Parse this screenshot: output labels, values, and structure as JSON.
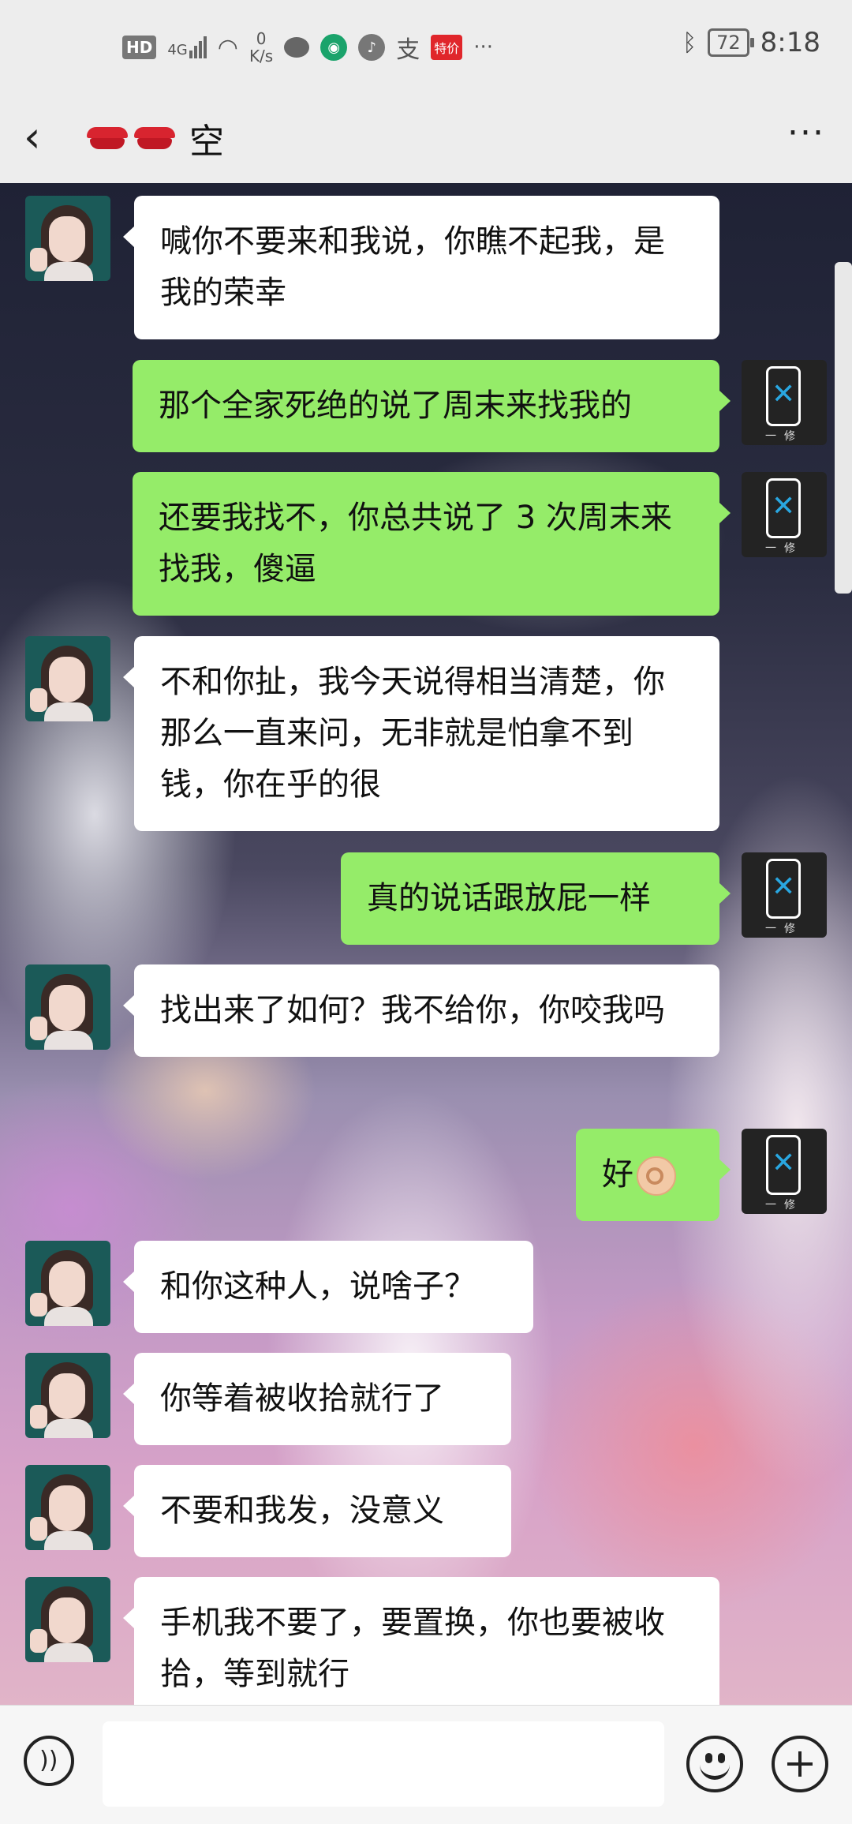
{
  "status_bar": {
    "hd": "HD",
    "network": "4G",
    "speed_value": "0",
    "speed_unit": "K/s",
    "pay_icon": "支",
    "sale_badge": "特价",
    "more": "···",
    "battery": "72",
    "time": "8:18"
  },
  "header": {
    "back_icon": "‹",
    "title": "空",
    "more_icon": "···"
  },
  "messages": [
    {
      "from": "other",
      "text": "喊你不要来和我说，你瞧不起我，是我的荣幸"
    },
    {
      "from": "me",
      "text": "那个全家死绝的说了周末来找我的"
    },
    {
      "from": "me",
      "text": "还要我找不，你总共说了 3 次周末来找我，傻逼"
    },
    {
      "from": "other",
      "text": "不和你扯，我今天说得相当清楚，你那么一直来问，无非就是怕拿不到钱，你在乎的很"
    },
    {
      "from": "me",
      "text": "真的说话跟放屁一样"
    },
    {
      "from": "other",
      "text": "找出来了如何？我不给你，你咬我吗"
    },
    {
      "from": "me",
      "text": "好"
    },
    {
      "from": "other",
      "text": "和你这种人，说啥子？"
    },
    {
      "from": "other",
      "text": "你等着被收拾就行了"
    },
    {
      "from": "other",
      "text": "不要和我发，没意义"
    },
    {
      "from": "other",
      "text": "手机我不要了，要置换，你也要被收拾，等到就行"
    }
  ],
  "my_avatar_label": "一修",
  "colors": {
    "sent_bubble": "#95ec69",
    "recv_bubble": "#ffffff",
    "bar_bg": "#ededed"
  }
}
